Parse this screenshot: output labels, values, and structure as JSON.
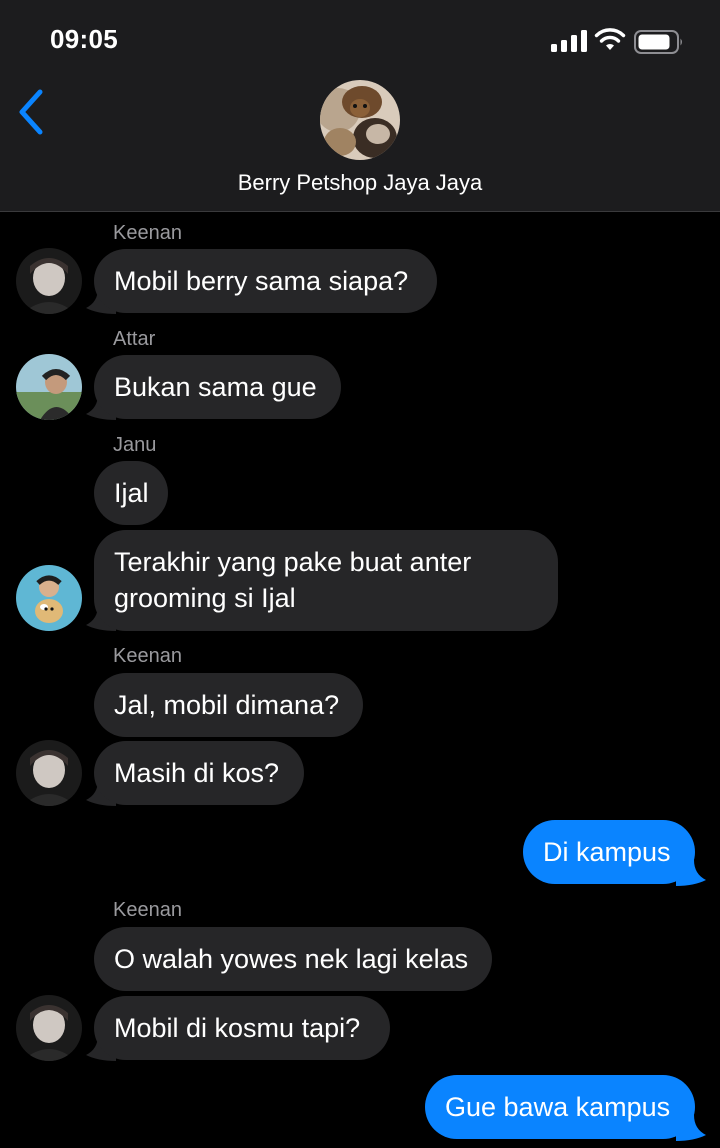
{
  "status_bar": {
    "time": "09:05",
    "signal_icon": "cellular-signal-icon",
    "wifi_icon": "wifi-icon",
    "battery_icon": "battery-icon"
  },
  "header": {
    "back_icon": "chevron-left-icon",
    "group_name": "Berry Petshop Jaya Jaya"
  },
  "colors": {
    "incoming_bubble": "#262628",
    "outgoing_bubble": "#0a84ff",
    "header_bg": "#1c1c1e",
    "accent": "#0a84ff"
  },
  "messages": [
    {
      "sender": "Keenan",
      "text": "Mobil berry sama siapa?",
      "direction": "in"
    },
    {
      "sender": "Attar",
      "text": "Bukan sama gue",
      "direction": "in"
    },
    {
      "sender": "Janu",
      "text": "Ijal",
      "direction": "in"
    },
    {
      "sender": "",
      "text": "Terakhir yang pake buat anter grooming si Ijal",
      "direction": "in"
    },
    {
      "sender": "Keenan",
      "text": "Jal, mobil dimana?",
      "direction": "in"
    },
    {
      "sender": "",
      "text": "Masih di kos?",
      "direction": "in"
    },
    {
      "sender": "",
      "text": "Di kampus",
      "direction": "out"
    },
    {
      "sender": "Keenan",
      "text": "O walah yowes nek lagi kelas",
      "direction": "in"
    },
    {
      "sender": "",
      "text": "Mobil di kosmu tapi?",
      "direction": "in"
    },
    {
      "sender": "",
      "text": "Gue bawa kampus",
      "direction": "out"
    }
  ]
}
